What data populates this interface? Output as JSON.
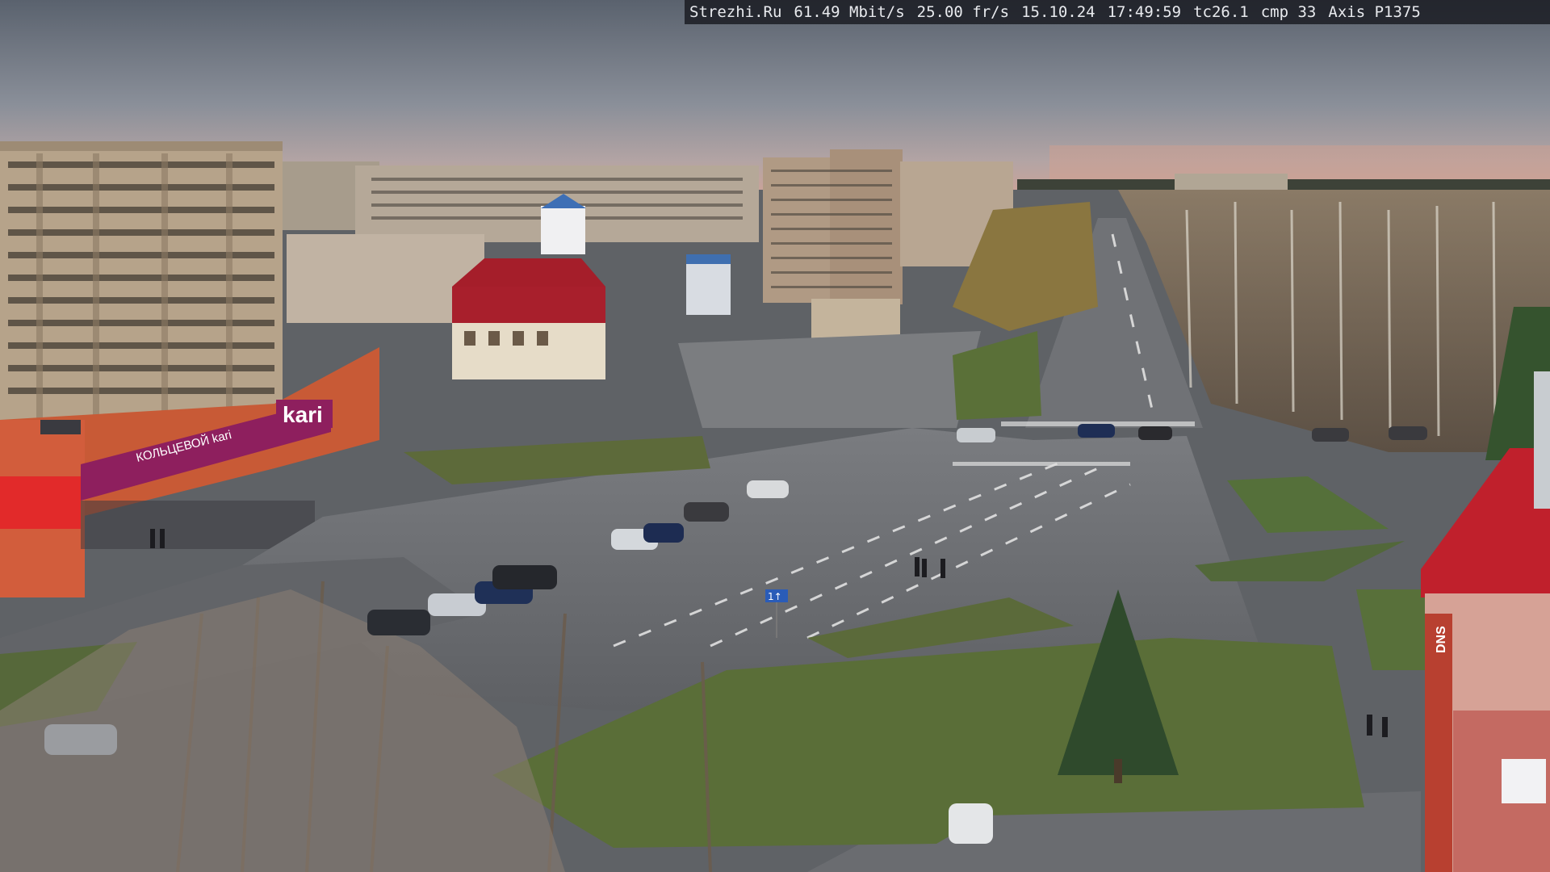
{
  "osd": {
    "site": "Strezhi.Ru",
    "bitrate": "61.49 Mbit/s",
    "framerate": "25.00 fr/s",
    "date": "15.10.24",
    "time": "17:49:59",
    "tc": "tc26.1",
    "cmp": "cmp 33",
    "camera_model": "Axis P1375"
  },
  "signage": {
    "store_brand": "kari",
    "store_banner": "КОЛЬЦЕВОЙ kari",
    "right_building_letters": "DNS"
  },
  "road_signs": {
    "lane_sign": "1↑"
  },
  "colors": {
    "sky_top": "#5d6571",
    "sky_horizon": "#c9a7a0",
    "road": "#6b6e72",
    "grass": "#5a6e3a",
    "kari_magenta": "#8e1f5e",
    "orange_building": "#d4643a",
    "red_roof": "#b8202a",
    "panel_building": "#b8a890"
  }
}
